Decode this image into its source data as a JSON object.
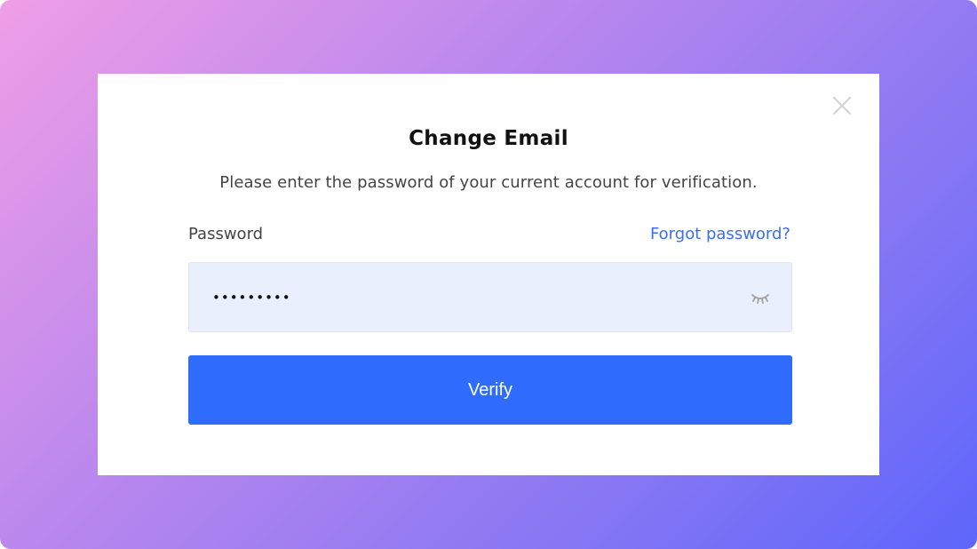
{
  "dialog": {
    "title": "Change Email",
    "subtitle": "Please enter the password of your current account for verification.",
    "close_icon": "close-icon"
  },
  "form": {
    "password_label": "Password",
    "forgot_link": "Forgot password?",
    "password_value": "•••••••••",
    "toggle_icon": "eye-closed-icon",
    "submit_label": "Verify"
  },
  "colors": {
    "accent": "#2f6bfd",
    "link": "#3b6ef0",
    "input_bg": "#e9effd",
    "gradient_start": "#ef9ee6",
    "gradient_end": "#5d66fb"
  }
}
